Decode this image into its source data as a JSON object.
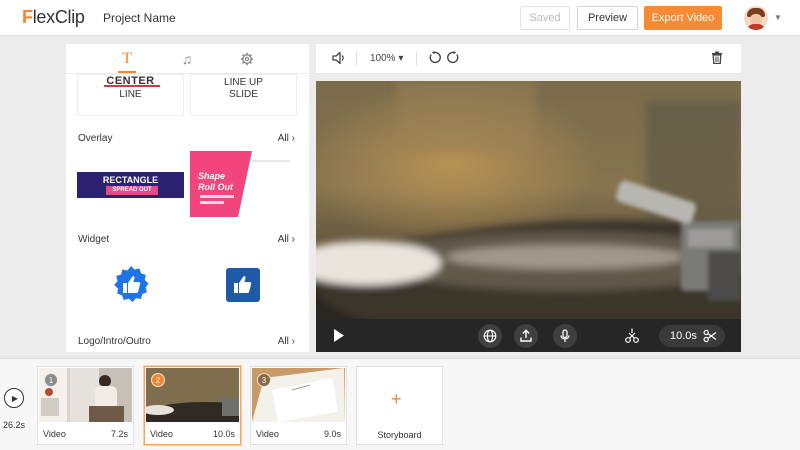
{
  "app": {
    "logo_mark": "F",
    "logo_rest": "lexClip",
    "project_name": "Project Name"
  },
  "header": {
    "saved_label": "Saved",
    "preview_label": "Preview",
    "export_label": "Export Video"
  },
  "left_panel": {
    "tabs": [
      {
        "icon": "text-icon",
        "glyph": "T",
        "active": true
      },
      {
        "icon": "music-icon",
        "glyph": "♫",
        "active": false
      },
      {
        "icon": "gear-icon",
        "glyph": "⚙",
        "active": false
      }
    ],
    "text_tiles": {
      "center_line": {
        "line1": "CENTER",
        "line2": "LINE"
      },
      "line_up_slide": {
        "line1": "LINE UP",
        "line2": "SLIDE"
      }
    },
    "sections": {
      "overlay": {
        "label": "Overlay",
        "all": "All"
      },
      "widget": {
        "label": "Widget",
        "all": "All"
      },
      "logo": {
        "label": "Logo/Intro/Outro",
        "all": "All"
      }
    },
    "overlay_tiles": {
      "rectangle": {
        "line1": "RECTANGLE",
        "line2": "SPREAD OUT"
      },
      "shape": {
        "line1": "Shape",
        "line2": "Roll Out"
      }
    }
  },
  "preview": {
    "zoom_label": "100%",
    "duration": "10.0s"
  },
  "timeline": {
    "total_time": "26.2s",
    "clips": [
      {
        "number": "1",
        "type": "Video",
        "duration": "7.2s",
        "active": false
      },
      {
        "number": "2",
        "type": "Video",
        "duration": "10.0s",
        "active": true
      },
      {
        "number": "3",
        "type": "Video",
        "duration": "9.0s",
        "active": false
      }
    ],
    "storyboard_label": "Storyboard"
  },
  "colors": {
    "accent": "#f68b33",
    "rect_purple": "#2b2272",
    "shape_pink": "#f2457c",
    "widget_blue": "#1e73e6",
    "widget_navy": "#1f5aa6"
  }
}
